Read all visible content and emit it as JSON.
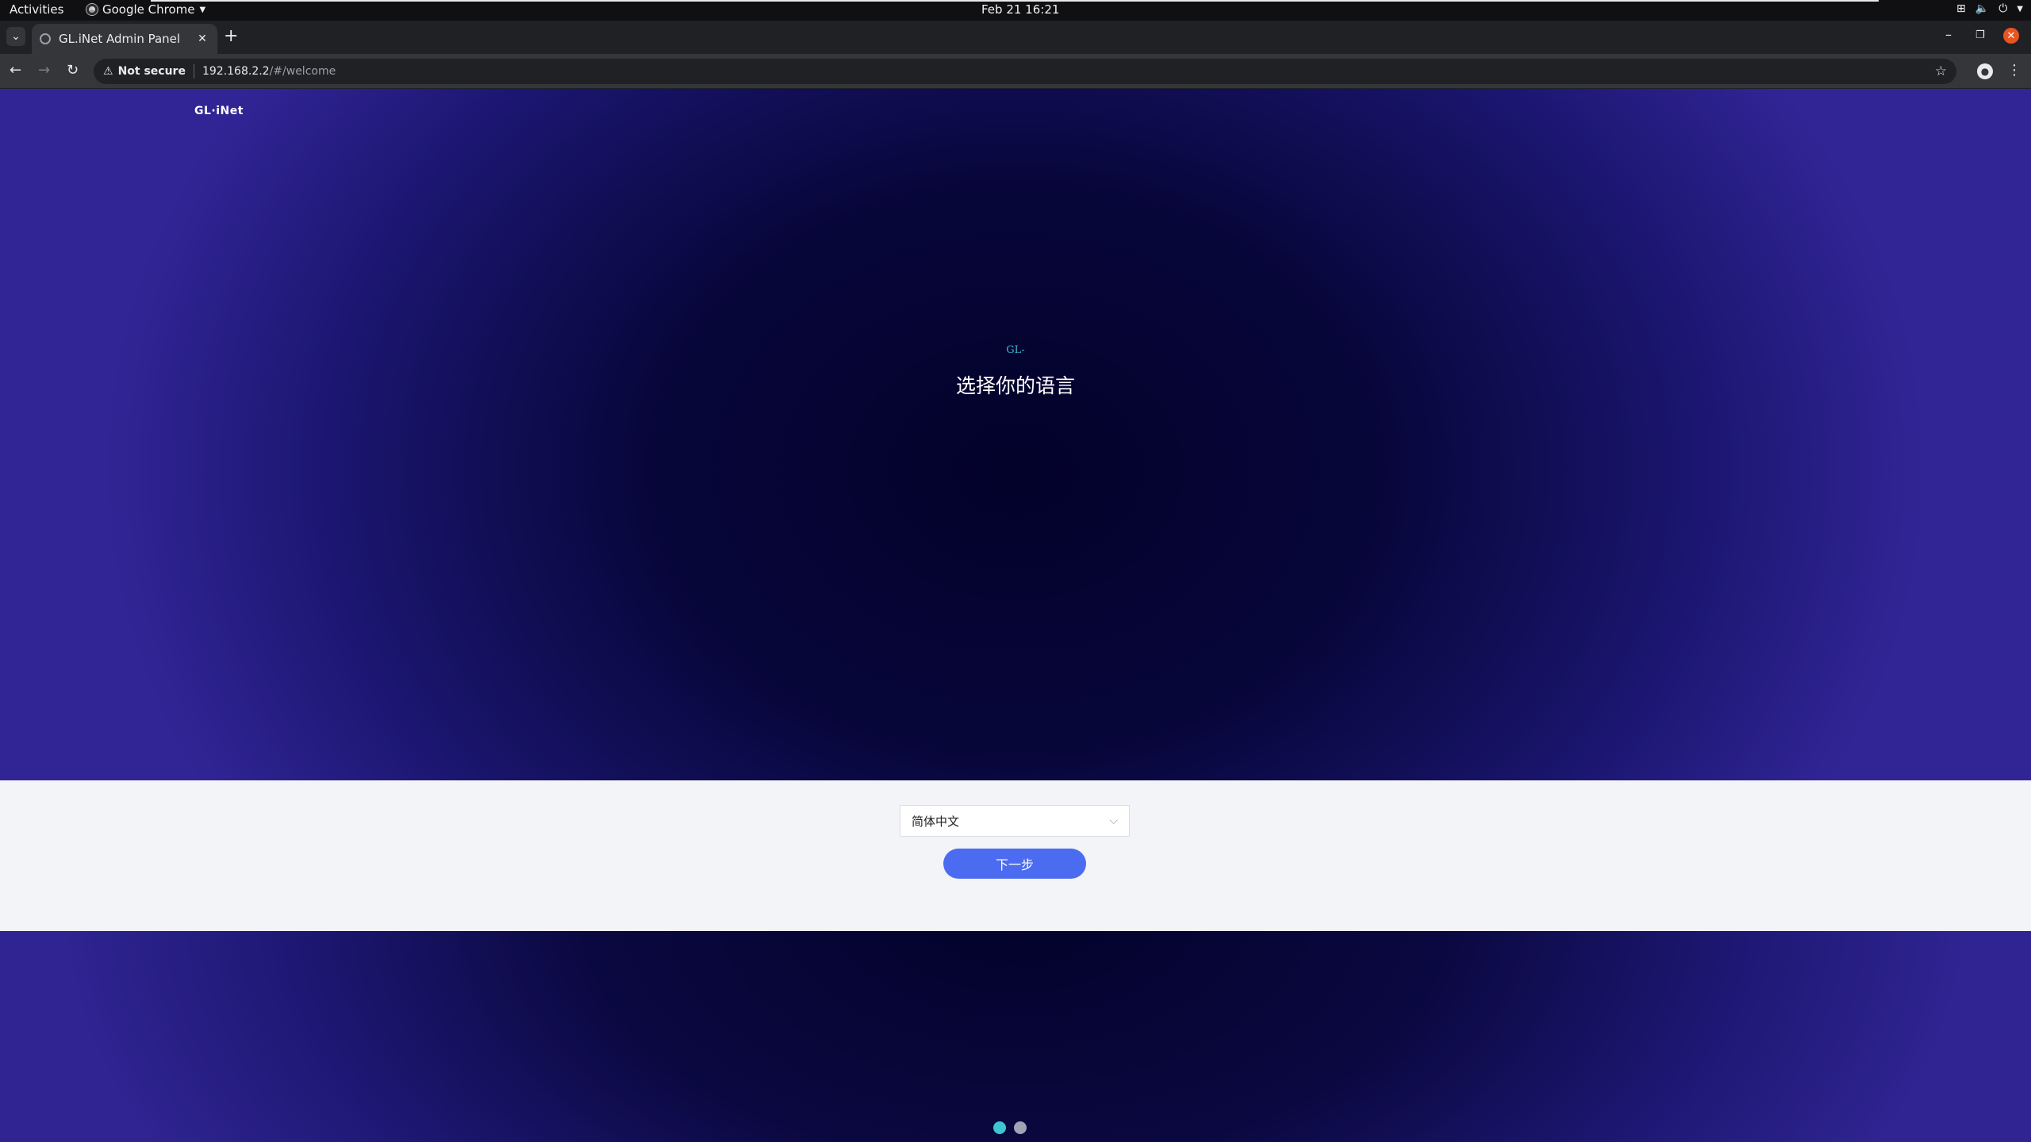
{
  "system_bar": {
    "activities": "Activities",
    "app_name": "Google Chrome",
    "clock": "Feb 21  16:21"
  },
  "browser": {
    "tab_title": "GL.iNet Admin Panel",
    "security_label": "Not secure",
    "url_host": "192.168.2.2",
    "url_path": "/#/welcome"
  },
  "page": {
    "logo_text": "GL·iNet",
    "brand_small": "GL-",
    "title": "选择你的语言",
    "language_select": {
      "selected": "简体中文"
    },
    "next_button": "下一步",
    "pagination": {
      "total": 2,
      "current": 1
    }
  },
  "colors": {
    "accent_button": "#4b6cf0",
    "dot_active": "#3ec5d2",
    "dot_inactive": "#9ea3b5",
    "hero_dark": "#03022a",
    "hero_edge": "#312596",
    "panel_bg": "#f3f4f8"
  }
}
